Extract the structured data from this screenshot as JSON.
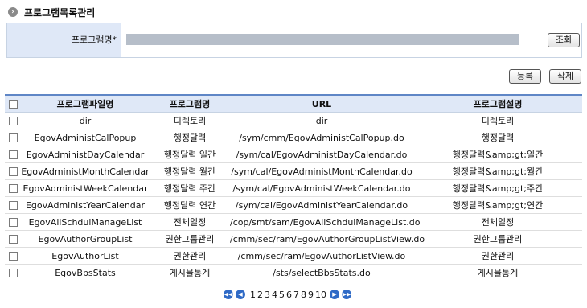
{
  "page": {
    "title": "프로그램목록관리"
  },
  "search": {
    "label": "프로그램명*",
    "value": "",
    "button": "조회"
  },
  "actions": {
    "register": "등록",
    "delete": "삭제"
  },
  "table": {
    "headers": [
      "프로그램파일명",
      "프로그램명",
      "URL",
      "프로그램설명"
    ],
    "rows": [
      {
        "file": "dir",
        "name": "디렉토리",
        "url": "dir",
        "desc": "디렉토리"
      },
      {
        "file": "EgovAdministCalPopup",
        "name": "행정달력",
        "url": "/sym/cmm/EgovAdministCalPopup.do",
        "desc": "행정달력"
      },
      {
        "file": "EgovAdministDayCalendar",
        "name": "행정달력 일간",
        "url": "/sym/cal/EgovAdministDayCalendar.do",
        "desc": "행정달력&amp;gt;일간"
      },
      {
        "file": "EgovAdministMonthCalendar",
        "name": "행정달력 월간",
        "url": "/sym/cal/EgovAdministMonthCalendar.do",
        "desc": "행정달력&amp;gt;월간"
      },
      {
        "file": "EgovAdministWeekCalendar",
        "name": "행정달력 주간",
        "url": "/sym/cal/EgovAdministWeekCalendar.do",
        "desc": "행정달력&amp;gt;주간"
      },
      {
        "file": "EgovAdministYearCalendar",
        "name": "행정달력 연간",
        "url": "/sym/cal/EgovAdministYearCalendar.do",
        "desc": "행정달력&amp;gt;연간"
      },
      {
        "file": "EgovAllSchdulManageList",
        "name": "전체일정",
        "url": "/cop/smt/sam/EgovAllSchdulManageList.do",
        "desc": "전체일정"
      },
      {
        "file": "EgovAuthorGroupList",
        "name": "권한그룹관리",
        "url": "/cmm/sec/ram/EgovAuthorGroupListView.do",
        "desc": "권한그룹관리"
      },
      {
        "file": "EgovAuthorList",
        "name": "권한관리",
        "url": "/cmm/sec/ram/EgovAuthorListView.do",
        "desc": "권한관리"
      },
      {
        "file": "EgovBbsStats",
        "name": "게시물통계",
        "url": "/sts/selectBbsStats.do",
        "desc": "게시물통계"
      }
    ]
  },
  "pagination": {
    "pages": [
      "1",
      "2",
      "3",
      "4",
      "5",
      "6",
      "7",
      "8",
      "9",
      "10"
    ]
  },
  "icons": {
    "title": "chevron-circle-icon",
    "first": "first-page-icon",
    "prev": "prev-page-icon",
    "next": "next-page-icon",
    "last": "last-page-icon"
  },
  "colors": {
    "header_bg": "#dfe8f7",
    "header_border": "#5f86c6",
    "pager_icon": "#2f6ac6"
  }
}
